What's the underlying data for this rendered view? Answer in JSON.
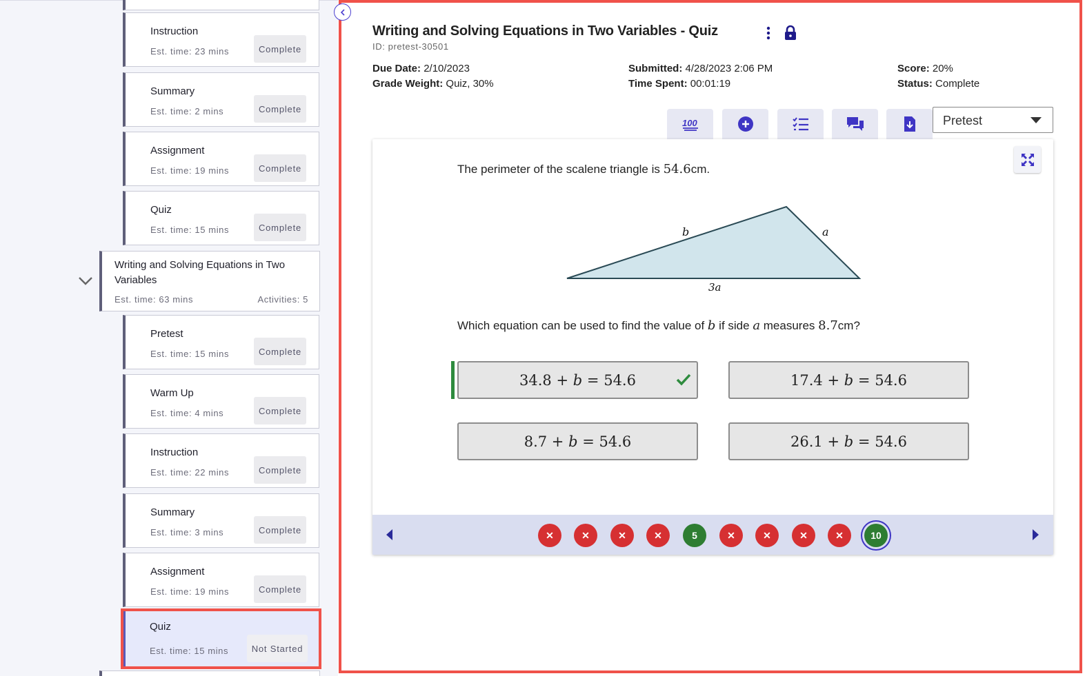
{
  "sidebar": {
    "activities_top": [
      {
        "title": "Instruction",
        "est": "Est. time: 23 mins",
        "status": "Complete"
      },
      {
        "title": "Summary",
        "est": "Est. time: 2 mins",
        "status": "Complete"
      },
      {
        "title": "Assignment",
        "est": "Est. time: 19 mins",
        "status": "Complete"
      },
      {
        "title": "Quiz",
        "est": "Est. time: 15 mins",
        "status": "Complete"
      }
    ],
    "lesson": {
      "title": "Writing and Solving Equations in Two Variables",
      "est": "Est. time: 63 mins",
      "activities": "Activities: 5"
    },
    "activities_bottom": [
      {
        "title": "Pretest",
        "est": "Est. time: 15 mins",
        "status": "Complete"
      },
      {
        "title": "Warm Up",
        "est": "Est. time: 4 mins",
        "status": "Complete"
      },
      {
        "title": "Instruction",
        "est": "Est. time: 22 mins",
        "status": "Complete"
      },
      {
        "title": "Summary",
        "est": "Est. time: 3 mins",
        "status": "Complete"
      },
      {
        "title": "Assignment",
        "est": "Est. time: 19 mins",
        "status": "Complete"
      },
      {
        "title": "Quiz",
        "est": "Est. time: 15 mins",
        "status": "Not Started"
      }
    ]
  },
  "header": {
    "title": "Writing and Solving Equations in Two Variables - Quiz",
    "id": "ID: pretest-30501",
    "due_date_label": "Due Date:",
    "due_date": "2/10/2023",
    "grade_weight_label": "Grade Weight:",
    "grade_weight": "Quiz, 30%",
    "submitted_label": "Submitted:",
    "submitted": "4/28/2023 2:06 PM",
    "time_spent_label": "Time Spent:",
    "time_spent": "00:01:19",
    "score_label": "Score:",
    "score": "20%",
    "status_label": "Status:",
    "status": "Complete"
  },
  "toolbar": {
    "icons": [
      "hundred-points-icon",
      "plus-circle-icon",
      "checklist-icon",
      "chat-icon",
      "file-download-icon"
    ],
    "select_value": "Pretest"
  },
  "question": {
    "prompt_pre": "The perimeter of the scalene triangle is ",
    "prompt_math": "54.6",
    "prompt_unit": "cm.",
    "side_b": "b",
    "side_a": "a",
    "side_base": "3a",
    "ask_1": "Which equation can be used to find the value of ",
    "ask_var1": "b",
    "ask_2": " if side ",
    "ask_var2": "a",
    "ask_3": " measures ",
    "ask_num": "8.7",
    "ask_4": "cm?",
    "choices": [
      {
        "left": "34.8",
        "right": "54.6",
        "correct": true
      },
      {
        "left": "17.4",
        "right": "54.6",
        "correct": false
      },
      {
        "left": "8.7",
        "right": "54.6",
        "correct": false
      },
      {
        "left": "26.1",
        "right": "54.6",
        "correct": false
      }
    ],
    "plus": "+",
    "var": "b",
    "equals": "="
  },
  "navigation": {
    "questions": [
      {
        "label": "✕",
        "result": "wrong"
      },
      {
        "label": "✕",
        "result": "wrong"
      },
      {
        "label": "✕",
        "result": "wrong"
      },
      {
        "label": "✕",
        "result": "wrong"
      },
      {
        "label": "5",
        "result": "correct"
      },
      {
        "label": "✕",
        "result": "wrong"
      },
      {
        "label": "✕",
        "result": "wrong"
      },
      {
        "label": "✕",
        "result": "wrong"
      },
      {
        "label": "✕",
        "result": "wrong"
      },
      {
        "label": "10",
        "result": "correct",
        "current": true
      }
    ]
  },
  "colors": {
    "accent": "#3f35c4",
    "highlight": "#f0524a",
    "correct": "#2e7d32",
    "wrong": "#d63032"
  }
}
